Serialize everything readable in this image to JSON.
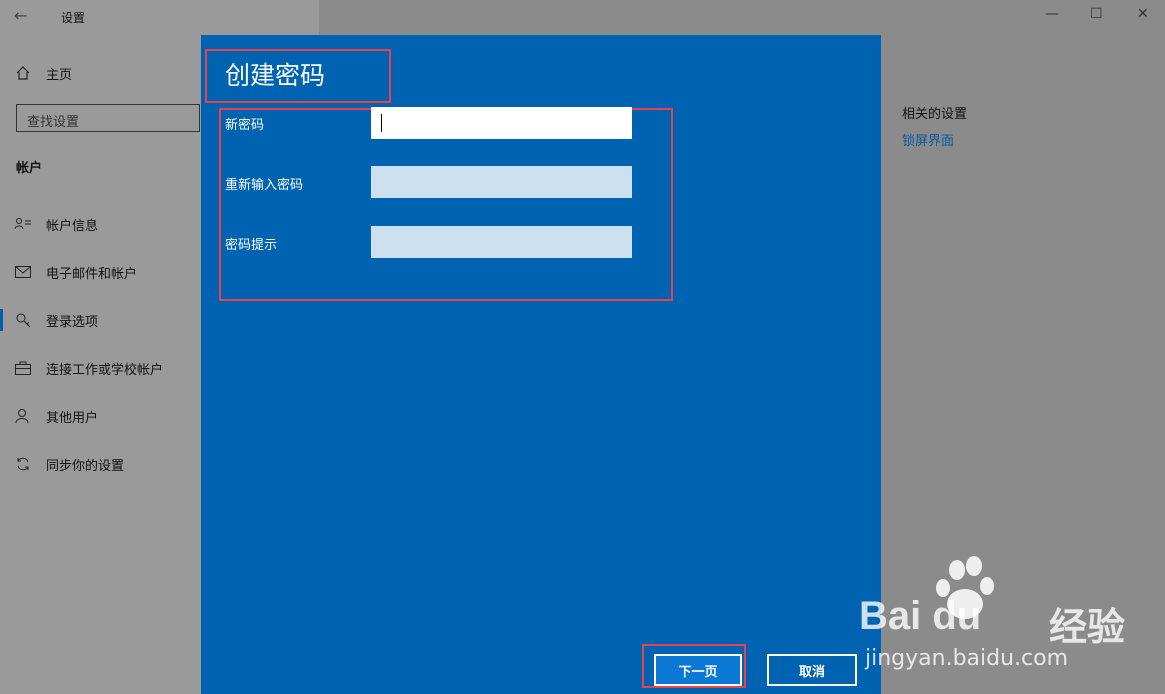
{
  "window": {
    "title": "设置"
  },
  "sidebar": {
    "home_label": "主页",
    "search_placeholder": "查找设置",
    "section_title": "帐户",
    "items": [
      {
        "label": "帐户信息",
        "icon": "person-card-icon"
      },
      {
        "label": "电子邮件和帐户",
        "icon": "mail-icon"
      },
      {
        "label": "登录选项",
        "icon": "key-icon"
      },
      {
        "label": "连接工作或学校帐户",
        "icon": "briefcase-icon"
      },
      {
        "label": "其他用户",
        "icon": "person-add-icon"
      },
      {
        "label": "同步你的设置",
        "icon": "sync-icon"
      }
    ]
  },
  "related": {
    "title": "相关的设置",
    "link": "锁屏界面"
  },
  "dialog": {
    "title": "创建密码",
    "fields": [
      {
        "label": "新密码",
        "value": ""
      },
      {
        "label": "重新输入密码",
        "value": ""
      },
      {
        "label": "密码提示",
        "value": ""
      }
    ],
    "next_button": "下一页",
    "cancel_button": "取消"
  },
  "watermark": {
    "brand": "Bai du",
    "product": "经验",
    "url": "jingyan.baidu.com"
  },
  "colors": {
    "dialog_bg": "#0063b1",
    "highlight": "#e8424c",
    "link": "#0a5a9e"
  }
}
